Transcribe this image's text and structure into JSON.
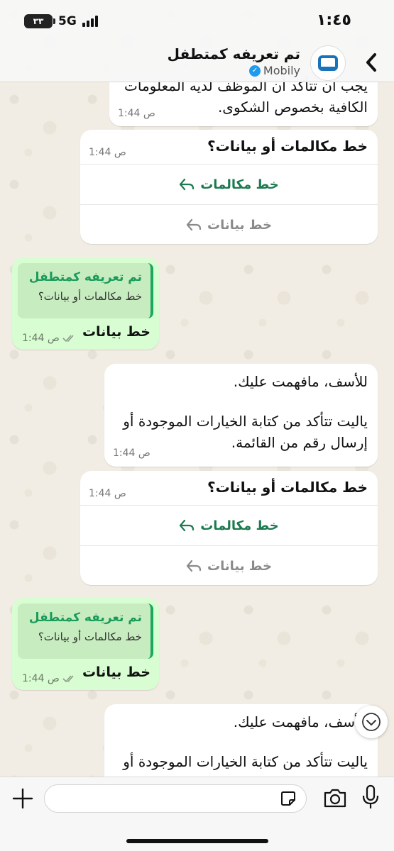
{
  "status_bar": {
    "time": "١:٤٥",
    "network": "5G",
    "battery": "٣٣"
  },
  "header": {
    "title": "تم تعريفه كمتطفل",
    "subtitle": "Mobily"
  },
  "messages": [
    {
      "type": "received",
      "lines": [
        "يجب ان تتأكد أن الموظف لديه المعلومات",
        "الكافية بخصوص الشكوى."
      ],
      "time": "1:44 ص"
    },
    {
      "type": "received_buttons",
      "text": "خط مكالمات أو بيانات؟",
      "time": "1:44 ص",
      "options": [
        "خط مكالمات",
        "خط بيانات"
      ]
    },
    {
      "type": "sent_reply",
      "quote_title": "تم تعريفه كمتطفل",
      "quote_body": "خط مكالمات أو بيانات؟",
      "text": "خط بيانات",
      "time": "1:44 ص"
    },
    {
      "type": "received",
      "lines": [
        "للأسف، مافهمت عليك.",
        "",
        "ياليت تتأكد من كتابة الخيارات الموجودة أو",
        "إرسال رقم من القائمة."
      ],
      "time": "1:44 ص"
    },
    {
      "type": "received_buttons",
      "text": "خط مكالمات أو بيانات؟",
      "time": "1:44 ص",
      "options": [
        "خط مكالمات",
        "خط بيانات"
      ]
    },
    {
      "type": "sent_reply",
      "quote_title": "تم تعريفه كمتطفل",
      "quote_body": "خط مكالمات أو بيانات؟",
      "text": "خط بيانات",
      "time": "1:44 ص"
    },
    {
      "type": "received",
      "lines": [
        "للأسف، مافهمت عليك.",
        "",
        "ياليت تتأكد من كتابة الخيارات الموجودة أو"
      ],
      "time": ""
    }
  ],
  "input": {
    "placeholder": ""
  },
  "colors": {
    "accent_green": "#1c7a4f",
    "sent_bubble": "#d8fdd2",
    "quote_bar": "#1aa760",
    "verified_blue": "#1d9bf0"
  },
  "icons": {
    "back": "chevron-left-icon",
    "verified": "verified-badge-icon",
    "reply": "reply-arrow-icon",
    "read": "double-check-icon",
    "scroll": "chevron-down-icon",
    "plus": "plus-icon",
    "sticker": "sticker-icon",
    "camera": "camera-icon",
    "mic": "microphone-icon"
  }
}
